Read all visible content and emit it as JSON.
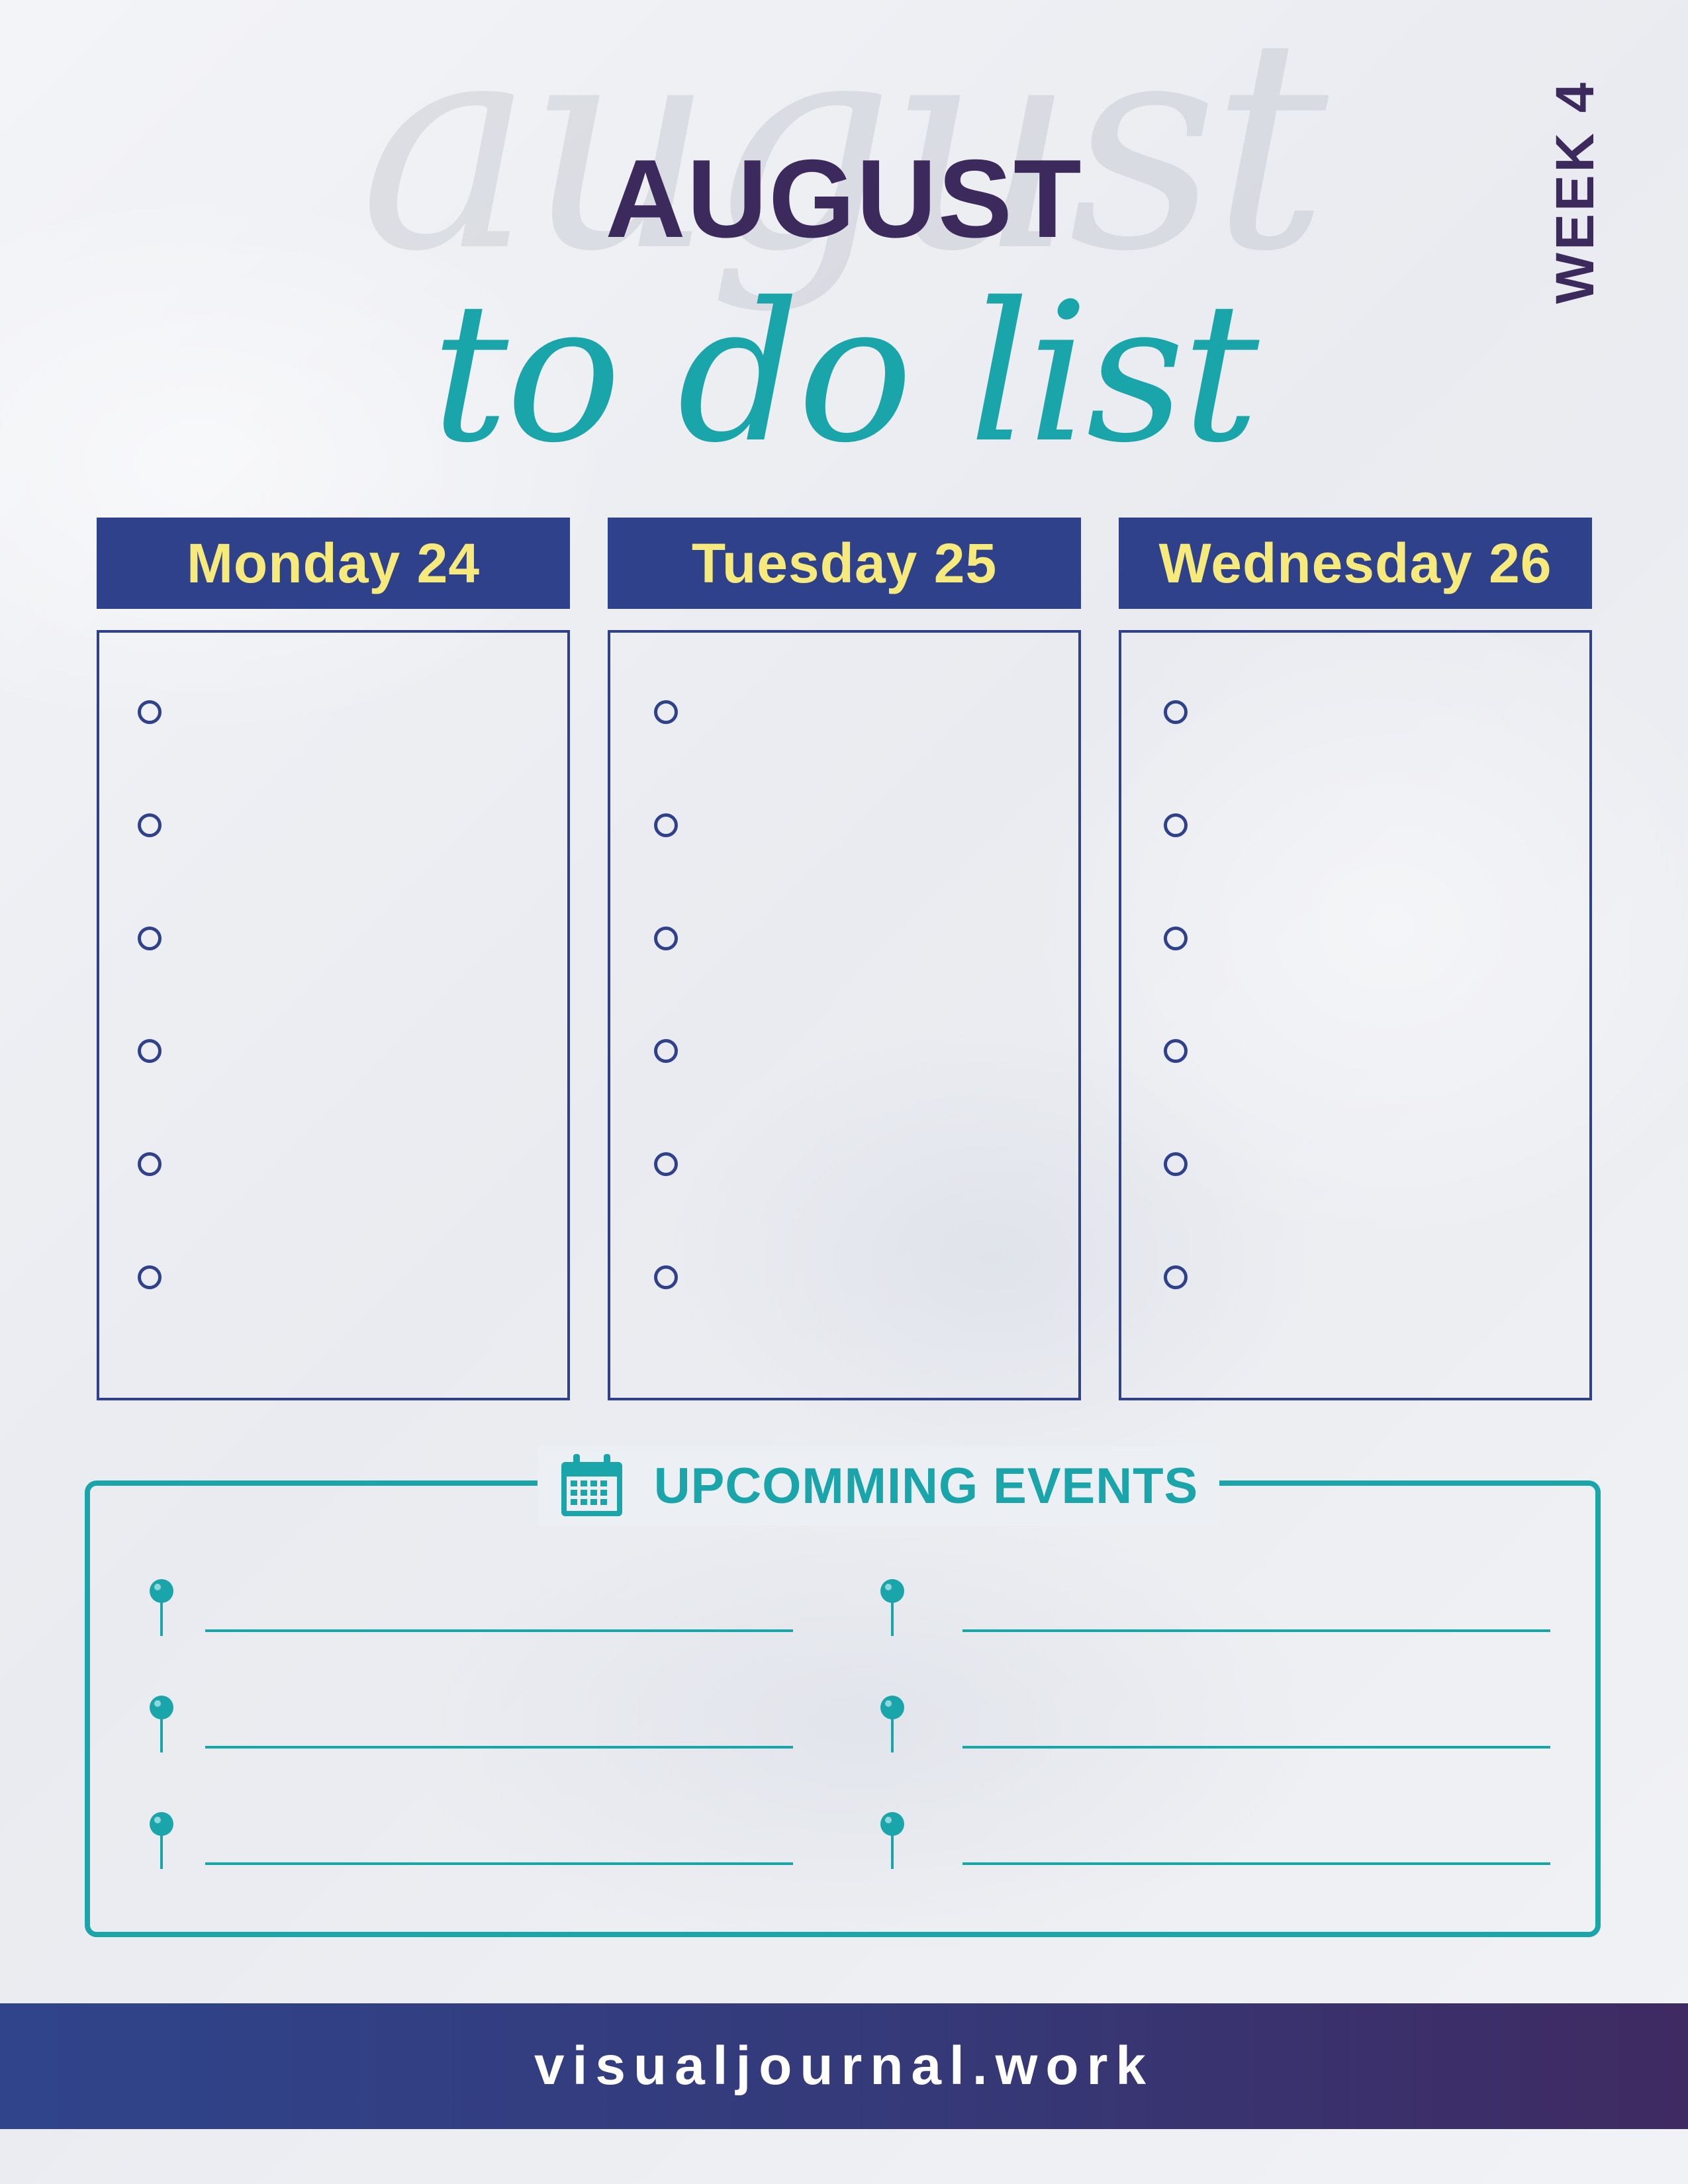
{
  "header": {
    "background_word": "august",
    "month": "AUGUST",
    "subtitle": "to do list",
    "week": "WEEK 4"
  },
  "days": [
    {
      "label": "Monday 24",
      "tasks": [
        "",
        "",
        "",
        "",
        "",
        ""
      ]
    },
    {
      "label": "Tuesday 25",
      "tasks": [
        "",
        "",
        "",
        "",
        "",
        ""
      ]
    },
    {
      "label": "Wednesday 26",
      "tasks": [
        "",
        "",
        "",
        "",
        "",
        ""
      ]
    }
  ],
  "events": {
    "title": "UPCOMMING EVENTS",
    "icon": "calendar-icon",
    "left_items": [
      "",
      "",
      ""
    ],
    "right_items": [
      "",
      "",
      ""
    ]
  },
  "footer": {
    "site": "visualjournal.work"
  },
  "colors": {
    "navy": "#2e418a",
    "purple": "#3c2a5c",
    "teal": "#1aa5aa",
    "yellow": "#f6ea7c"
  }
}
